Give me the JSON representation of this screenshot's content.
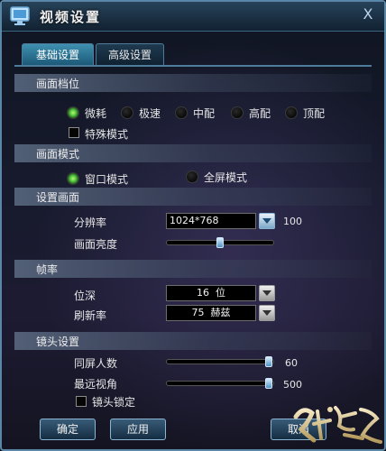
{
  "window": {
    "title": "视频设置",
    "close_symbol": "X"
  },
  "tabs": [
    {
      "label": "基础设置",
      "active": true
    },
    {
      "label": "高级设置",
      "active": false
    }
  ],
  "sections": {
    "quality": "画面档位",
    "mode": "画面模式",
    "display": "设置画面",
    "fps": "帧率",
    "camera": "镜头设置"
  },
  "quality": {
    "options": [
      "微耗",
      "极速",
      "中配",
      "高配",
      "顶配"
    ],
    "selected": "微耗",
    "special_mode_label": "特殊模式",
    "special_mode_checked": false
  },
  "mode": {
    "options": [
      "窗口模式",
      "全屏模式"
    ],
    "selected": "窗口模式"
  },
  "display": {
    "resolution_label": "分辨率",
    "resolution_value": "1024*768",
    "resolution_extra": "100",
    "brightness_label": "画面亮度",
    "brightness_level": 0.5
  },
  "fps": {
    "depth_label": "位深",
    "depth_value": "16  位",
    "refresh_label": "刷新率",
    "refresh_value": "75  赫兹"
  },
  "camera": {
    "same_screen_label": "同屏人数",
    "same_screen_value": "60",
    "same_screen_level": 0.98,
    "view_angle_label": "最远视角",
    "view_angle_value": "500",
    "view_angle_level": 0.98,
    "lock_label": "镜头锁定",
    "lock_checked": false
  },
  "buttons": {
    "ok": "确定",
    "apply": "应用",
    "cancel": "取消"
  },
  "logo": {
    "text": "醉逍遥"
  },
  "colors": {
    "accent": "#3f8fb0",
    "radio_on": "#4fc33c",
    "border": "#5a87a8"
  }
}
